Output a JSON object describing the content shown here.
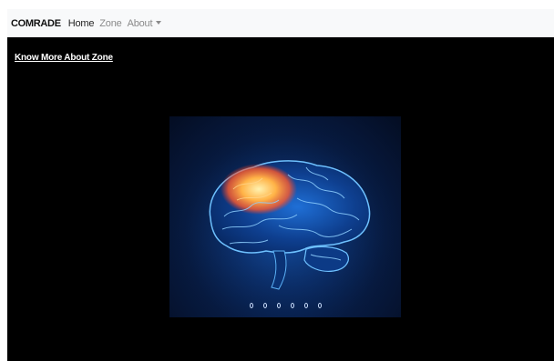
{
  "navbar": {
    "brand": "COMRADE",
    "links": [
      {
        "label": "Home",
        "active": true
      },
      {
        "label": "Zone",
        "active": false
      },
      {
        "label": "About",
        "active": false,
        "dropdown": true
      }
    ]
  },
  "main": {
    "cta_link": "Know More About Zone"
  },
  "carousel": {
    "image_icon": "brain-illustration",
    "slide_count": 6,
    "active_index": 0
  },
  "colors": {
    "page_background": "#000000",
    "navbar_background": "#f8f9fa",
    "brain_glow": "#ff9a3a",
    "brain_blue": "#3aa0ff"
  }
}
